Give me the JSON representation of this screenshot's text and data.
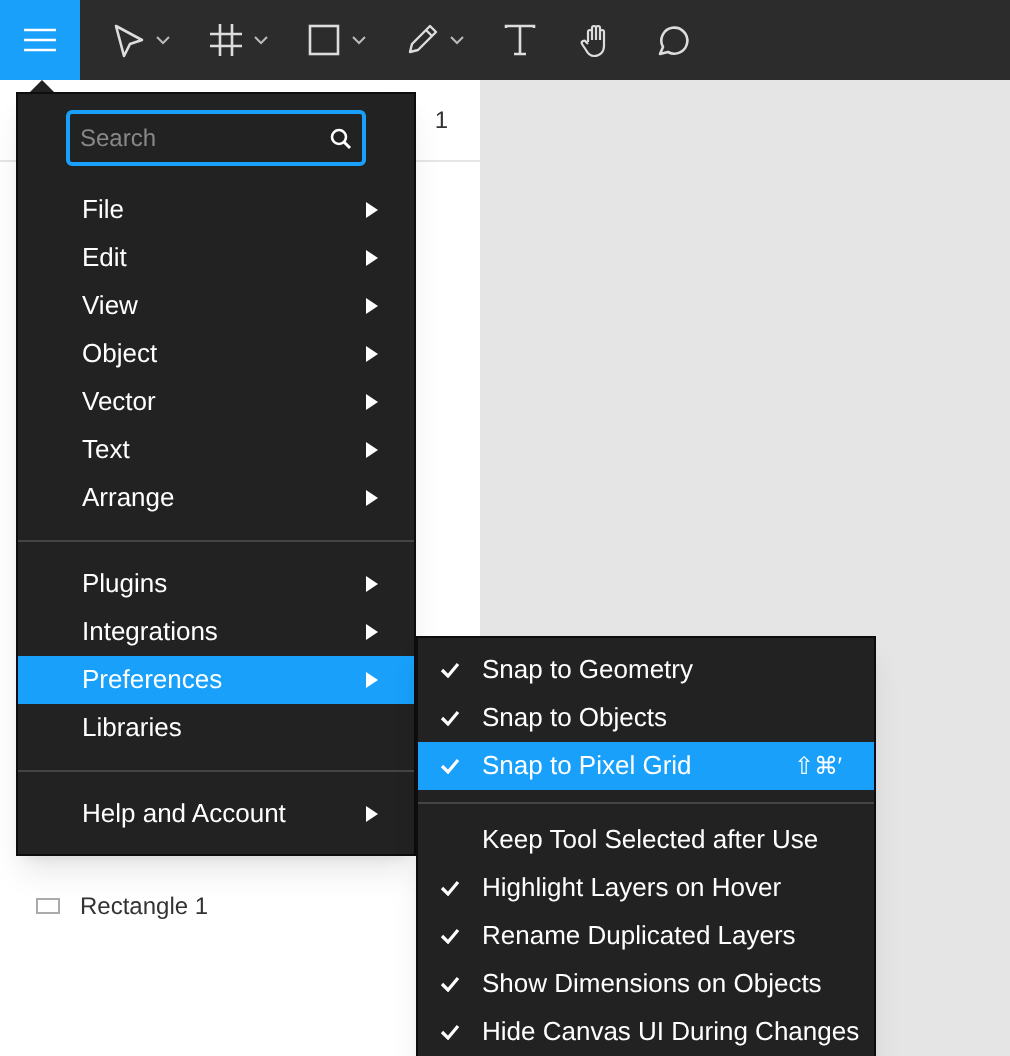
{
  "toolbar": {
    "menu_button": {
      "selected": true
    },
    "tools": [
      {
        "kind": "move",
        "dropdown": true
      },
      {
        "kind": "frame",
        "dropdown": true
      },
      {
        "kind": "rectangle",
        "dropdown": true
      },
      {
        "kind": "pen",
        "dropdown": true
      },
      {
        "kind": "text",
        "dropdown": false
      },
      {
        "kind": "hand",
        "dropdown": false
      },
      {
        "kind": "comment",
        "dropdown": false
      }
    ]
  },
  "page_selector": {
    "label": "1"
  },
  "layers": [
    {
      "label": "Rectangle 1"
    }
  ],
  "main_menu": {
    "search": {
      "placeholder": "Search"
    },
    "groups": [
      [
        {
          "label": "File",
          "submenu": true,
          "selected": false
        },
        {
          "label": "Edit",
          "submenu": true,
          "selected": false
        },
        {
          "label": "View",
          "submenu": true,
          "selected": false
        },
        {
          "label": "Object",
          "submenu": true,
          "selected": false
        },
        {
          "label": "Vector",
          "submenu": true,
          "selected": false
        },
        {
          "label": "Text",
          "submenu": true,
          "selected": false
        },
        {
          "label": "Arrange",
          "submenu": true,
          "selected": false
        }
      ],
      [
        {
          "label": "Plugins",
          "submenu": true,
          "selected": false
        },
        {
          "label": "Integrations",
          "submenu": true,
          "selected": false
        },
        {
          "label": "Preferences",
          "submenu": true,
          "selected": true
        },
        {
          "label": "Libraries",
          "submenu": false,
          "selected": false
        }
      ],
      [
        {
          "label": "Help and Account",
          "submenu": true,
          "selected": false
        }
      ]
    ]
  },
  "preferences_menu": {
    "groups": [
      [
        {
          "label": "Snap to Geometry",
          "checked": true,
          "selected": false
        },
        {
          "label": "Snap to Objects",
          "checked": true,
          "selected": false
        },
        {
          "label": "Snap to Pixel Grid",
          "checked": true,
          "selected": true,
          "shortcut": "⇧⌘′"
        }
      ],
      [
        {
          "label": "Keep Tool Selected after Use",
          "checked": false,
          "selected": false
        },
        {
          "label": "Highlight Layers on Hover",
          "checked": true,
          "selected": false
        },
        {
          "label": "Rename Duplicated Layers",
          "checked": true,
          "selected": false
        },
        {
          "label": "Show Dimensions on Objects",
          "checked": true,
          "selected": false
        },
        {
          "label": "Hide Canvas UI During Changes",
          "checked": true,
          "selected": false
        }
      ]
    ]
  }
}
